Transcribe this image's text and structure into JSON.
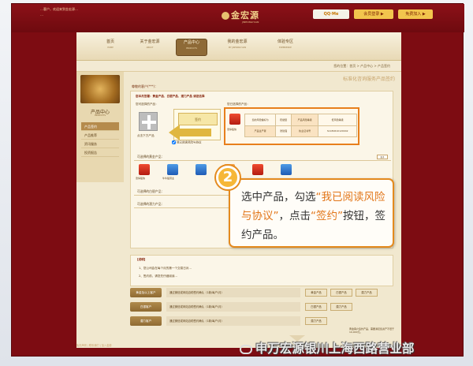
{
  "header": {
    "top_text": "…客户，欢迎来到金宏源…",
    "top_text2": "…",
    "logo": "金宏源",
    "logo_sub": "JINHONGYUAN",
    "qq_label": "QQ·Me",
    "login_label": "会员登录 ▶",
    "register_label": "免费加入 ▶"
  },
  "nav": {
    "items": [
      {
        "label": "首页",
        "sub": "HOME"
      },
      {
        "label": "关于金宏源",
        "sub": "ABOUT"
      },
      {
        "label": "产品中心",
        "sub": "PRODUCTS"
      },
      {
        "label": "我的金宏源",
        "sub": "MY JINHONGYUAN"
      },
      {
        "label": "体验专区",
        "sub": "EXPERIENCE"
      }
    ]
  },
  "breadcrumb": "您的位置：首页 > 产品中心 > 产品签约",
  "sidebar": {
    "title": "产品中心",
    "subtitle": "PRODUCTS",
    "menu": [
      "产品签约",
      "产品推荐",
      "资讯服务",
      "投资报告"
    ]
  },
  "main": {
    "page_title": "标准化咨询服务产品签约",
    "greeting": "尊敬的客户(***)：",
    "intro": "您本月签署：黄金产品、白银产品、潜力产品  请您选择",
    "choose_label": "您可选择的产品：",
    "selected_label": "您已选择的产品：",
    "plus_caption": "点击下方产品",
    "sign_button": "签约",
    "agree_text": "我已阅读风险与协议",
    "product_name": "涨停股快",
    "info_table": [
      [
        "您的风险偏好为",
        "稳健型",
        "产品风险等级",
        "低风险等级"
      ],
      [
        "产品生产者",
        "张建强",
        "执业证书号",
        "S1180610120042"
      ]
    ],
    "sections": {
      "gold": "可选择的黄金产品：",
      "silver": "可选择的白银产品：",
      "potential": "可选择的潜力产品："
    },
    "more": "更多",
    "gold_products": [
      "涨停股快",
      "牛牛股营业",
      "",
      "",
      "",
      ""
    ],
    "explain_title": "【说明】",
    "explain_lines": [
      "1、您公司会在每个月的第一个交易日对…",
      "2、签约前，请您先仔细阅读…"
    ],
    "rows": [
      {
        "label": "黄金及以上客户",
        "text": "通过微信或网站自助签约确认（1款/每户/月）",
        "btns": [
          "黄金产品",
          "白银产品",
          "潜力产品"
        ]
      },
      {
        "label": "白银客户",
        "text": "通过微信或网站自助签约确认（1款/每户/月）",
        "btns": [
          "白银产品",
          "潜力产品"
        ]
      },
      {
        "label": "潜力客户",
        "text": "通过微信或网站自助签约确认（1款/每户/月）",
        "btns": [
          "潜力产品"
        ]
      }
    ],
    "note": "黄金客户签约产品，需要满足您资产不低于10,000元。"
  },
  "footer": "免责声明 | 联系我们 | 加入金源",
  "callout": {
    "step": "2",
    "line_pre": "选中产品，勾选",
    "highlight1": "“我已阅读风险与协议”",
    "line_mid": "，点击",
    "highlight2": "“签约”",
    "line_post": "按钮，签约产品。"
  },
  "watermark": "申万宏源银川上海西路营业部"
}
